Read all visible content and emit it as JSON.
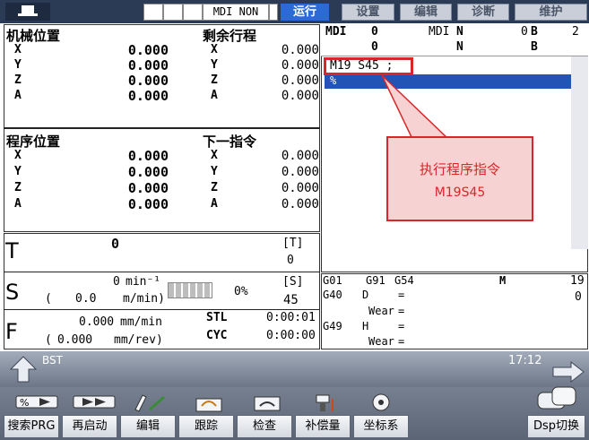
{
  "topbar": {
    "mode": "MDI NON",
    "tabs": [
      "运行",
      "设置",
      "编辑",
      "诊断",
      "维护"
    ]
  },
  "machine_pos": {
    "title": "机械位置",
    "axes": [
      {
        "axis": "X",
        "value": "0.000"
      },
      {
        "axis": "Y",
        "value": "0.000"
      },
      {
        "axis": "Z",
        "value": "0.000"
      },
      {
        "axis": "A",
        "value": "0.000"
      }
    ]
  },
  "remaining": {
    "title": "剩余行程",
    "axes": [
      {
        "axis": "X",
        "value": "0.000"
      },
      {
        "axis": "Y",
        "value": "0.000"
      },
      {
        "axis": "Z",
        "value": "0.000"
      },
      {
        "axis": "A",
        "value": "0.000"
      }
    ]
  },
  "program_pos": {
    "title": "程序位置",
    "axes": [
      {
        "axis": "X",
        "value": "0.000"
      },
      {
        "axis": "Y",
        "value": "0.000"
      },
      {
        "axis": "Z",
        "value": "0.000"
      },
      {
        "axis": "A",
        "value": "0.000"
      }
    ]
  },
  "next_cmd": {
    "title": "下一指令",
    "axes": [
      {
        "axis": "X",
        "value": "0.000"
      },
      {
        "axis": "Y",
        "value": "0.000"
      },
      {
        "axis": "Z",
        "value": "0.000"
      },
      {
        "axis": "A",
        "value": "0.000"
      }
    ]
  },
  "mdi_header": {
    "mdi": "MDI",
    "zero1": "0",
    "zero2": "0",
    "mdi_n": "MDI",
    "n1": "N",
    "n2": "N",
    "b_num": "0",
    "b1": "B",
    "b2": "B",
    "right_num": "2"
  },
  "program": {
    "line1": "M19 S45 ;",
    "line2": "%"
  },
  "callout": {
    "line1": "执行程序指令",
    "line2": "M19S45"
  },
  "tool": {
    "t_label": "T",
    "t_value": "0",
    "t_bracket": "[T]",
    "t_bracket_val": "0"
  },
  "spindle": {
    "s_label": "S",
    "s_value": "0",
    "s_unit": "min⁻¹",
    "s_paren_open": "(",
    "s_speed": "0.0",
    "s_unit2": "m/min)",
    "s_percent": "0%",
    "s_bracket": "[S]",
    "s_bracket_val": "45"
  },
  "feed": {
    "f_label": "F",
    "f_value": "0.000",
    "f_unit": "mm/min",
    "f_paren_open": "(",
    "f_value2": "0.000",
    "f_unit2": "mm/rev)",
    "stl": "STL",
    "stl_time": "0:00:01",
    "cyc": "CYC",
    "cyc_time": "0:00:00"
  },
  "gcodes": {
    "g01": "G01",
    "g91": "G91",
    "g54": "G54",
    "g40": "G40",
    "d": "D",
    "eq1": "=",
    "wear1": "Wear",
    "eq2": "=",
    "g49": "G49",
    "h": "H",
    "eq3": "=",
    "wear2": "Wear",
    "eq4": "=",
    "m": "M",
    "m_val1": "19",
    "m_val2": "0"
  },
  "status": {
    "bst": "BST",
    "time": "17:12"
  },
  "softkeys": [
    "搜索PRG",
    "再启动",
    "编辑",
    "跟踪",
    "检查",
    "补偿量",
    "坐标系",
    "Dsp切换"
  ]
}
